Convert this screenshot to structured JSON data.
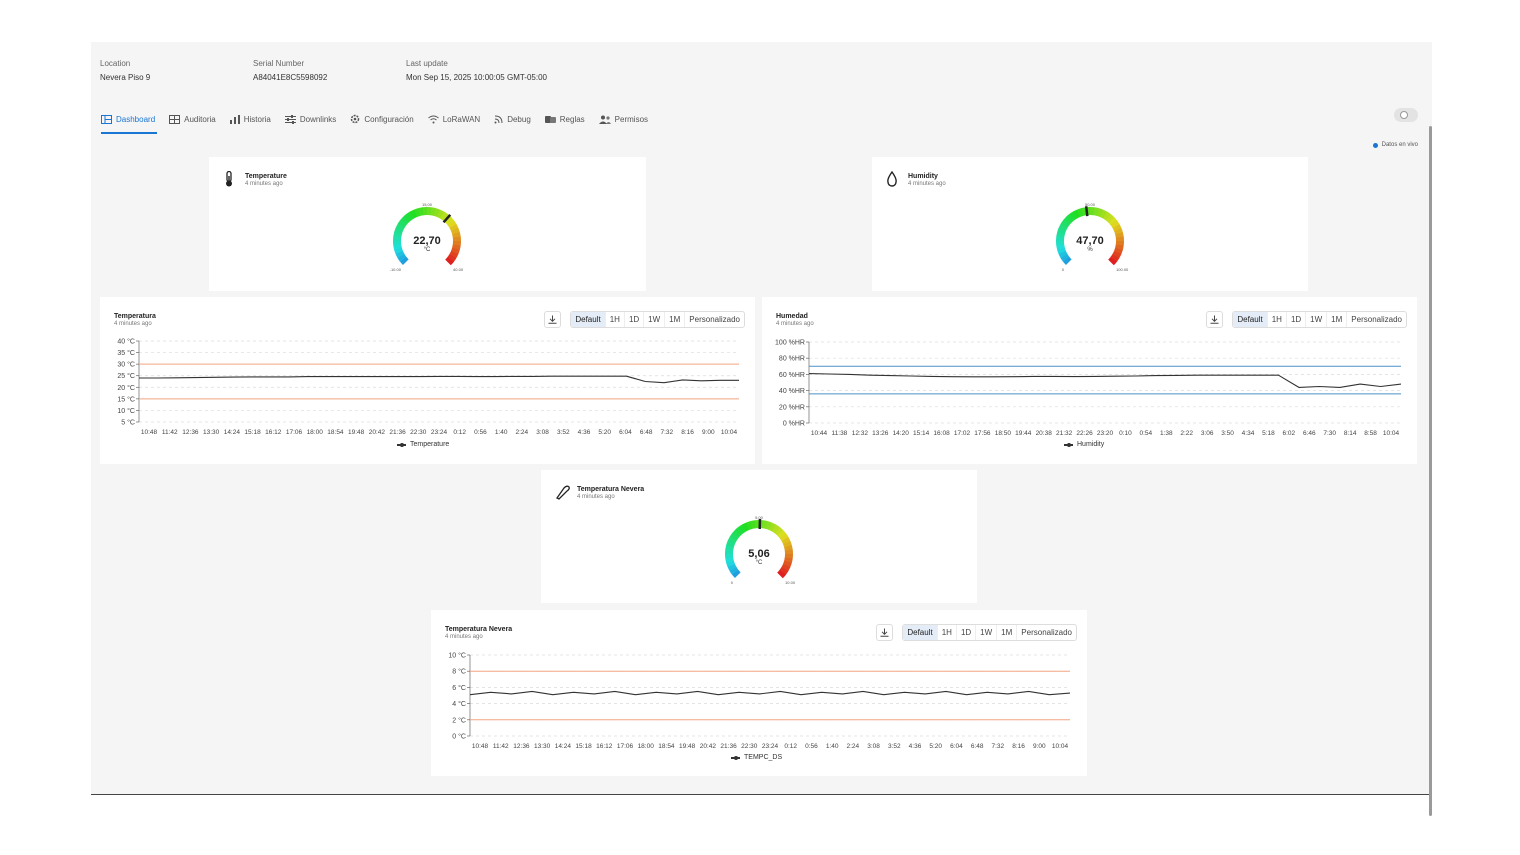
{
  "header": {
    "location_label": "Location",
    "location_value": "Nevera Piso 9",
    "serial_label": "Serial Number",
    "serial_value": "A84041E8C5598092",
    "update_label": "Last update",
    "update_value": "Mon Sep 15, 2025 10:00:05 GMT-05:00"
  },
  "tabs": [
    {
      "label": "Dashboard",
      "icon": "dashboard-icon",
      "active": true
    },
    {
      "label": "Auditoria",
      "icon": "table-icon"
    },
    {
      "label": "Historia",
      "icon": "bar-chart-icon"
    },
    {
      "label": "Downlinks",
      "icon": "sliders-icon"
    },
    {
      "label": "Configuración",
      "icon": "gear-icon"
    },
    {
      "label": "LoRaWAN",
      "icon": "wifi-icon"
    },
    {
      "label": "Debug",
      "icon": "rss-icon"
    },
    {
      "label": "Reglas",
      "icon": "rules-icon"
    },
    {
      "label": "Permisos",
      "icon": "users-icon"
    }
  ],
  "live_label": "Datos en vivo",
  "colors": {
    "accent": "#1976d2",
    "threshold": "#f4a582",
    "threshold_blue": "#4a90c8",
    "line": "#333333"
  },
  "gauges": {
    "temperature": {
      "title": "Temperature",
      "sub": "4 minutes ago",
      "value": "22,70",
      "unit": "°C",
      "min": "-10,00",
      "max": "40,00",
      "mid": "15,00",
      "numeric": 22.7,
      "lo": -10,
      "hi": 40
    },
    "humidity": {
      "title": "Humidity",
      "sub": "4 minutes ago",
      "value": "47,70",
      "unit": "%",
      "min": "0",
      "max": "100,00",
      "mid": "50,00",
      "numeric": 47.7,
      "lo": 0,
      "hi": 100
    },
    "nevera": {
      "title": "Temperatura Nevera",
      "sub": "4 minutes ago",
      "value": "5,06",
      "unit": "°C",
      "min": "0",
      "max": "10,00",
      "mid": "5,00",
      "numeric": 5.06,
      "lo": 0,
      "hi": 10
    }
  },
  "range_buttons": [
    "Default",
    "1H",
    "1D",
    "1W",
    "1M",
    "Personalizado"
  ],
  "charts": {
    "temperatura": {
      "title": "Temperatura",
      "sub": "4 minutes ago",
      "legend": "Temperature"
    },
    "humedad": {
      "title": "Humedad",
      "sub": "4 minutes ago",
      "legend": "Humidity"
    },
    "nevera": {
      "title": "Temperatura Nevera",
      "sub": "4 minutes ago",
      "legend": "TEMPC_DS"
    }
  },
  "chart_data": [
    {
      "type": "line",
      "title": "Temperatura",
      "series": [
        {
          "name": "Temperature",
          "values": [
            24.0,
            24.0,
            24.1,
            24.2,
            24.3,
            24.4,
            24.5,
            24.5,
            24.5,
            24.6,
            24.6,
            24.6,
            24.6,
            24.6,
            24.6,
            24.6,
            24.7,
            24.7,
            24.6,
            24.6,
            24.7,
            24.7,
            24.8,
            24.8,
            24.8,
            24.8,
            24.8,
            22.5,
            22.0,
            23.2,
            22.8,
            23.0,
            23.0
          ]
        }
      ],
      "x": [
        "10:48",
        "11:42",
        "12:36",
        "13:30",
        "14:24",
        "15:18",
        "16:12",
        "17:06",
        "18:00",
        "18:54",
        "19:48",
        "20:42",
        "21:36",
        "22:30",
        "23:24",
        "0:12",
        "0:56",
        "1:40",
        "2:24",
        "3:08",
        "3:52",
        "4:36",
        "5:20",
        "6:04",
        "6:48",
        "7:32",
        "8:16",
        "9:00",
        "10:04"
      ],
      "y_ticks": [
        "5 °C",
        "10 °C",
        "15 °C",
        "20 °C",
        "25 °C",
        "30 °C",
        "35 °C",
        "40 °C"
      ],
      "ylim": [
        5,
        40
      ],
      "thresholds": [
        {
          "value": 30,
          "color": "#f4a582"
        },
        {
          "value": 15,
          "color": "#f4a582"
        }
      ],
      "grid": true,
      "legend": "bottom"
    },
    {
      "type": "line",
      "title": "Humedad",
      "series": [
        {
          "name": "Humidity",
          "values": [
            61.0,
            60.5,
            60.0,
            59.0,
            58.5,
            58.0,
            57.5,
            57.2,
            57.0,
            57.0,
            57.2,
            57.5,
            57.5,
            57.3,
            57.5,
            57.8,
            58.0,
            58.5,
            58.8,
            59.0,
            59.0,
            59.0,
            59.0,
            59.0,
            44.0,
            45.0,
            44.0,
            48.0,
            45.0,
            48.0
          ]
        }
      ],
      "x": [
        "10:44",
        "11:38",
        "12:32",
        "13:26",
        "14:20",
        "15:14",
        "16:08",
        "17:02",
        "17:56",
        "18:50",
        "19:44",
        "20:38",
        "21:32",
        "22:26",
        "23:20",
        "0:10",
        "0:54",
        "1:38",
        "2:22",
        "3:06",
        "3:50",
        "4:34",
        "5:18",
        "6:02",
        "6:46",
        "7:30",
        "8:14",
        "8:58",
        "10:04"
      ],
      "y_ticks": [
        "0 %HR",
        "20 %HR",
        "40 %HR",
        "60 %HR",
        "80 %HR",
        "100 %HR"
      ],
      "ylim": [
        0,
        100
      ],
      "thresholds": [
        {
          "value": 70,
          "color": "#4a90c8"
        },
        {
          "value": 36,
          "color": "#4a90c8"
        }
      ],
      "grid": true,
      "legend": "bottom"
    },
    {
      "type": "line",
      "title": "Temperatura Nevera",
      "series": [
        {
          "name": "TEMPC_DS",
          "values": [
            5.1,
            5.4,
            5.2,
            5.5,
            5.1,
            5.4,
            5.2,
            5.5,
            5.1,
            5.4,
            5.2,
            5.5,
            5.1,
            5.4,
            5.2,
            5.5,
            5.1,
            5.4,
            5.2,
            5.5,
            5.1,
            5.4,
            5.2,
            5.5,
            5.1,
            5.4,
            5.2,
            5.5,
            5.1,
            5.3
          ]
        }
      ],
      "x": [
        "10:48",
        "11:42",
        "12:36",
        "13:30",
        "14:24",
        "15:18",
        "16:12",
        "17:06",
        "18:00",
        "18:54",
        "19:48",
        "20:42",
        "21:36",
        "22:30",
        "23:24",
        "0:12",
        "0:56",
        "1:40",
        "2:24",
        "3:08",
        "3:52",
        "4:36",
        "5:20",
        "6:04",
        "6:48",
        "7:32",
        "8:16",
        "9:00",
        "10:04"
      ],
      "y_ticks": [
        "0 °C",
        "2 °C",
        "4 °C",
        "6 °C",
        "8 °C",
        "10 °C"
      ],
      "ylim": [
        0,
        10
      ],
      "thresholds": [
        {
          "value": 8,
          "color": "#f4a582"
        },
        {
          "value": 2,
          "color": "#f4a582"
        }
      ],
      "grid": true,
      "legend": "bottom"
    }
  ]
}
